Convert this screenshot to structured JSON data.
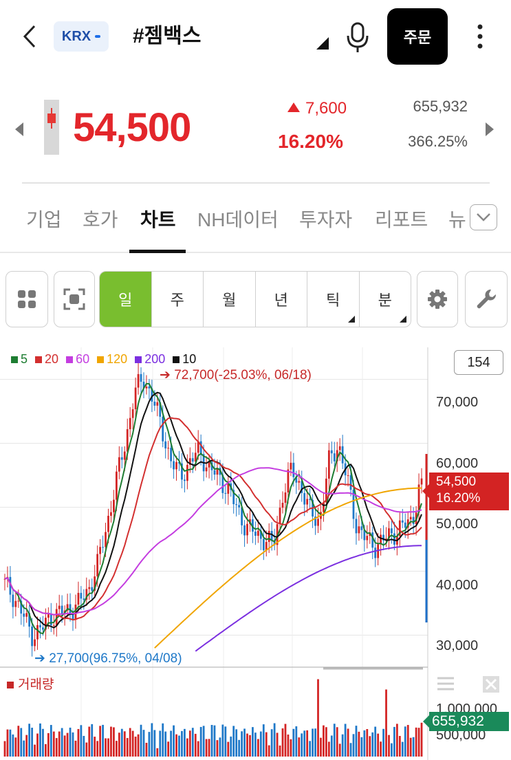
{
  "header": {
    "market_badge": "KRX",
    "stock_name": "#젬백스",
    "order_button": "주문"
  },
  "quote": {
    "price": "54,500",
    "change": "7,600",
    "change_pct": "16.20%",
    "volume": "655,932",
    "volume_ratio": "366.25%"
  },
  "tabs": [
    {
      "label": "기업"
    },
    {
      "label": "호가"
    },
    {
      "label": "차트",
      "active": true
    },
    {
      "label": "NH데이터"
    },
    {
      "label": "투자자"
    },
    {
      "label": "리포트"
    },
    {
      "label": "뉴"
    }
  ],
  "toolbar": {
    "periods": [
      "일",
      "주",
      "월",
      "년",
      "틱",
      "분"
    ],
    "selected_period": "일"
  },
  "chart": {
    "legend": [
      {
        "label": "5",
        "color": "#1e7d32"
      },
      {
        "label": "20",
        "color": "#d32f2f"
      },
      {
        "label": "60",
        "color": "#c43de0"
      },
      {
        "label": "120",
        "color": "#f0a500"
      },
      {
        "label": "200",
        "color": "#7b2fe0"
      },
      {
        "label": "10",
        "color": "#111111"
      }
    ],
    "max_note": "72,700(-25.03%, 06/18)",
    "min_note": "27,700(96.75%, 04/08)",
    "count_box": "154",
    "y_labels": [
      "70,000",
      "60,000",
      "50,000",
      "40,000",
      "30,000"
    ],
    "price_tag_price": "54,500",
    "price_tag_pct": "16.20%",
    "volume_legend": "거래량",
    "volume_labels": [
      "1,000,000",
      "500,000"
    ],
    "volume_tag": "655,932"
  },
  "chart_data": {
    "type": "candlestick",
    "y_range": [
      25000,
      75000
    ],
    "price_axis_ticks": [
      70000,
      60000,
      50000,
      40000,
      30000
    ],
    "close_series_approx": [
      38000,
      36000,
      33000,
      30000,
      31000,
      33000,
      33500,
      34000,
      35000,
      37000,
      41000,
      47000,
      54000,
      60000,
      68000,
      70000,
      67000,
      62000,
      57000,
      55000,
      57000,
      59000,
      56000,
      55000,
      53000,
      50000,
      47000,
      46000,
      45000,
      44000,
      52000,
      56000,
      53000,
      49000,
      48000,
      57000,
      60000,
      54000,
      47000,
      45000,
      44000,
      45000,
      46000,
      47000,
      48000,
      54500
    ],
    "high_point": {
      "value": 72700,
      "label": "72,700(-25.03%, 06/18)"
    },
    "low_point": {
      "value": 27700,
      "label": "27,700(96.75%, 04/08)"
    },
    "ma_levels_at_end": {
      "5": 46500,
      "20": 48500,
      "60": 49500,
      "120": 53000,
      "200": 44000
    },
    "volume_axis_ticks": [
      1000000,
      500000
    ],
    "last_volume": 655932
  }
}
